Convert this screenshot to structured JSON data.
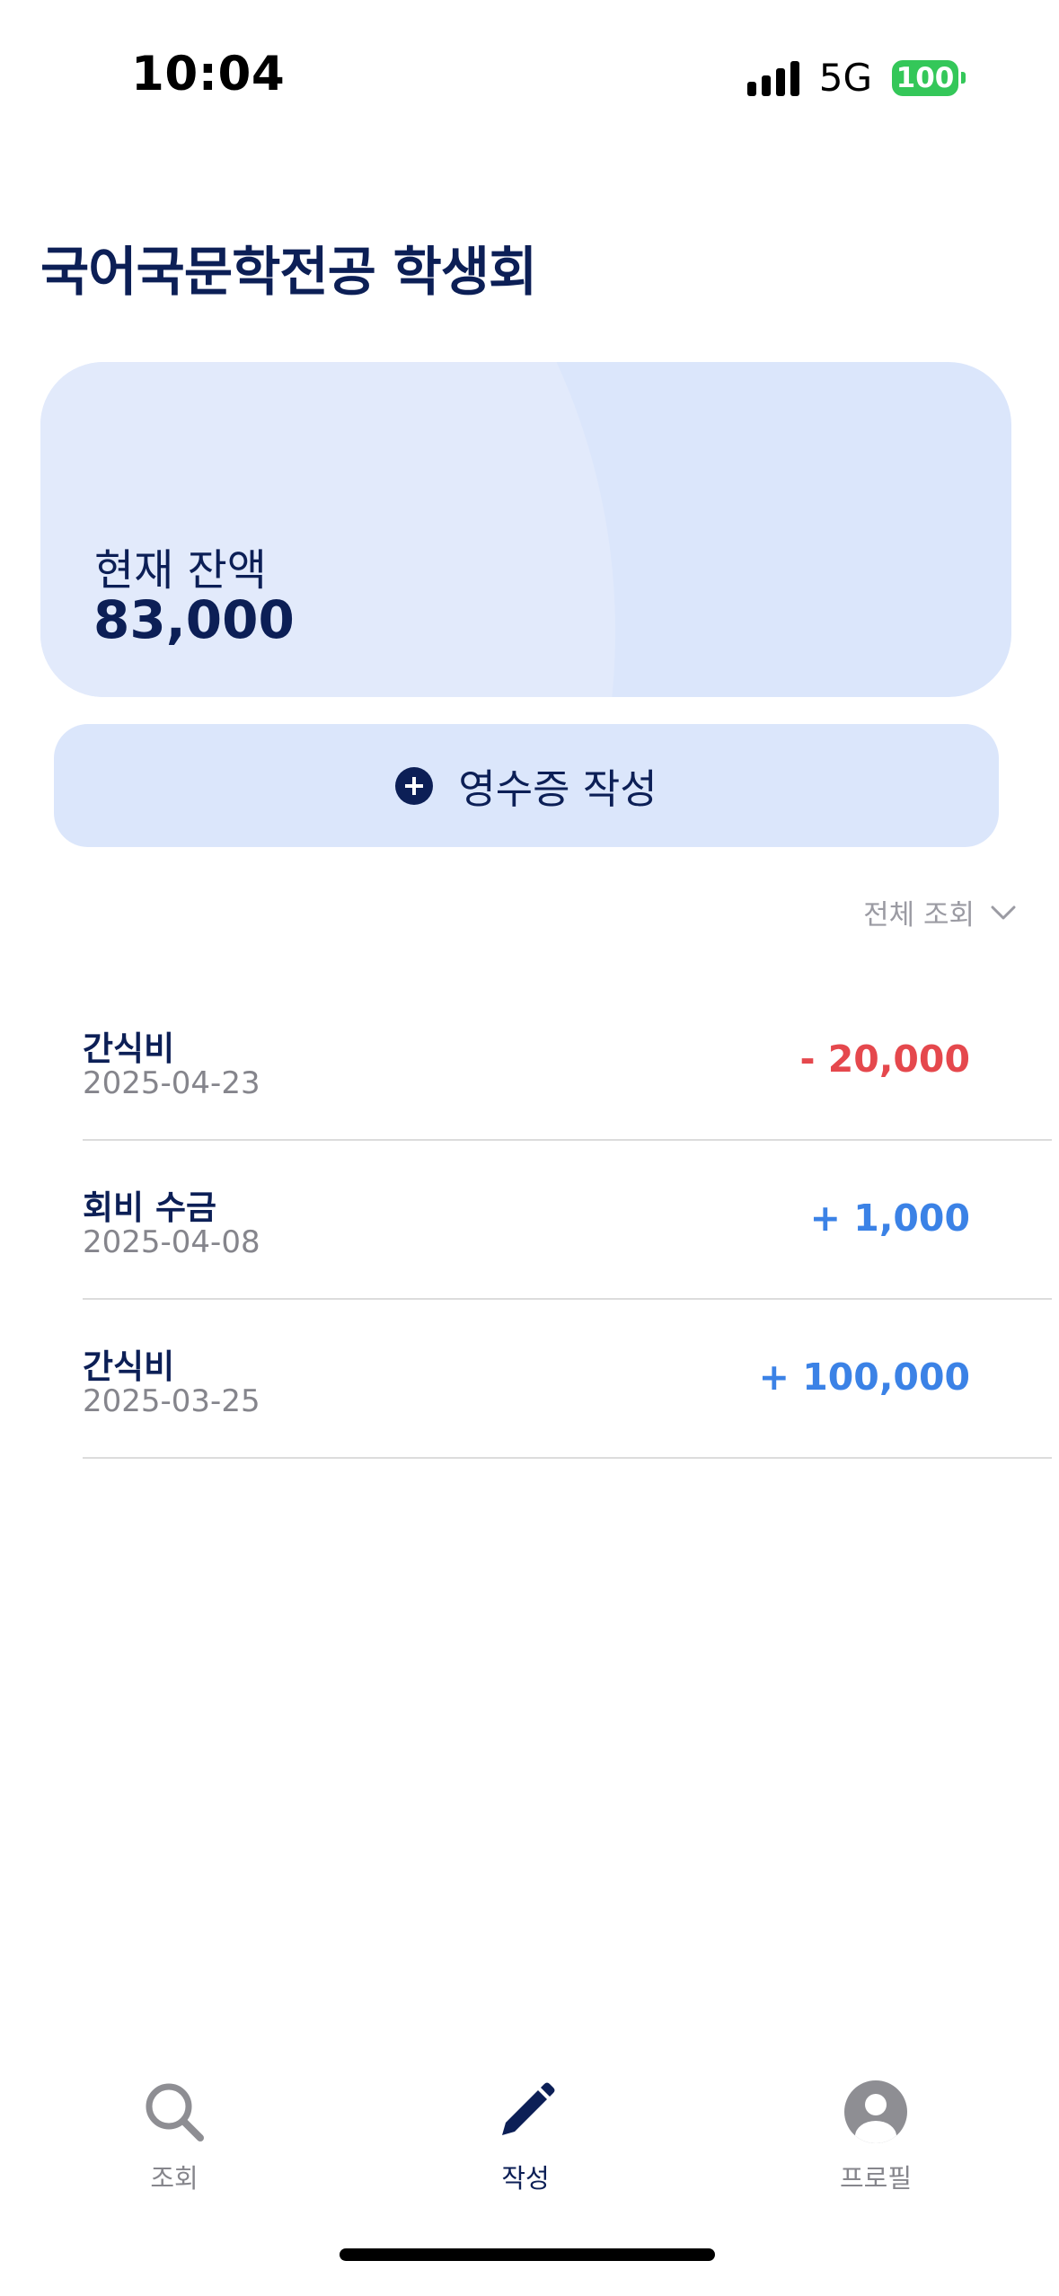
{
  "status_bar": {
    "time": "10:04",
    "network": "5G",
    "battery": "100",
    "signal_icon": "cellular-signal-icon",
    "battery_color": "#34c759"
  },
  "page": {
    "title": "국어국문학전공 학생회"
  },
  "balance_card": {
    "label": "현재 잔액",
    "amount": "83,000"
  },
  "receipt_button": {
    "icon": "plus-circle-icon",
    "label": "영수증 작성"
  },
  "filter": {
    "label": "전체 조회",
    "icon": "chevron-down-icon"
  },
  "transactions": [
    {
      "title": "간식비",
      "date": "2025-04-23",
      "amount": "- 20,000",
      "type": "expense"
    },
    {
      "title": "회비 수금",
      "date": "2025-04-08",
      "amount": "+ 1,000",
      "type": "income"
    },
    {
      "title": "간식비",
      "date": "2025-03-25",
      "amount": "+ 100,000",
      "type": "income"
    }
  ],
  "tab_bar": {
    "tabs": [
      {
        "label": "조회",
        "icon": "search-icon",
        "active": false
      },
      {
        "label": "작성",
        "icon": "pencil-icon",
        "active": true
      },
      {
        "label": "프로필",
        "icon": "profile-icon",
        "active": false
      }
    ]
  },
  "colors": {
    "primary": "#0c1f56",
    "card_bg": "#dbe6fb",
    "expense": "#e5484d",
    "income": "#3b82e6",
    "muted": "#86868c"
  }
}
